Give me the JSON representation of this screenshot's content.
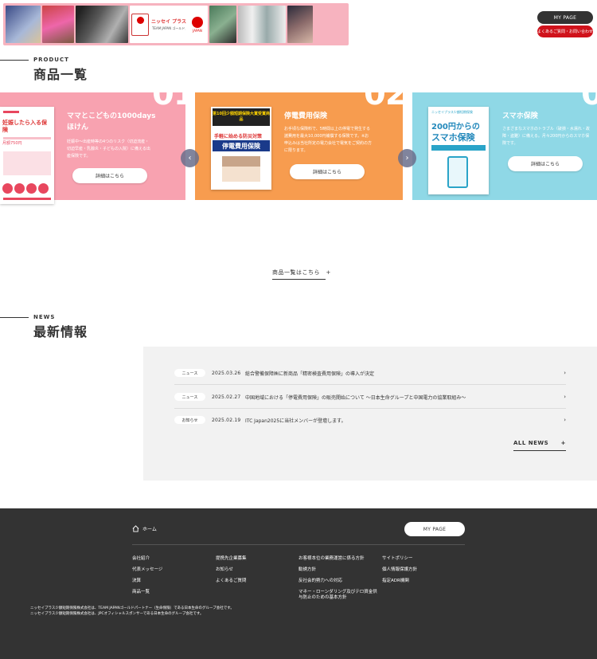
{
  "banner": {
    "promo_brand": "ニッセイ プラス",
    "promo_sub": "TEAM JAPAN ゴールドパートナー（生命保険）JPCオフィシャルスポンサー",
    "promo_japan": "JAPAN"
  },
  "header": {
    "mypage_label": "MY PAGE",
    "inquiry_label": "よくあるご質問・お問い合わせ"
  },
  "product_section": {
    "label": "PRODUCT",
    "title": "商品一覧",
    "numbers": [
      "01",
      "02",
      "0"
    ],
    "cards": [
      {
        "title": "ママとこどもの1000daysほけん",
        "desc": "妊娠中〜出産時等の4つのリスク（切迫流産・切迫早産・乳腺炎・子どもの入院）に備える出産保険です。",
        "button": "詳細はこちら",
        "img_head": "妊娠したら入る保険",
        "img_sub": "月額750円"
      },
      {
        "title": "停電費用保険",
        "desc": "お手頃な保険料で、5時間以上の停電で発生する諸費用を最大10,000円補償する保険です。※お申込みは当社所定の電力会社で電気をご契約の方に限ります。",
        "button": "詳細はこちら",
        "img_head": "第10回少額短期保険大賞受賞商品",
        "img_red": "手軽に始める防災対策",
        "img_banner": "停電費用保険"
      },
      {
        "title": "スマホ保険",
        "desc": "さまざまなスマホのトラブル（破損・水濡れ・故障・盗難）に備える。月々200円からのスマホ保険です。",
        "button": "詳細はこちら",
        "img_top": "ニッセイプラス少額短期保険",
        "img_price": "200円からの",
        "img_title": "スマホ保険"
      }
    ],
    "prev_icon": "‹",
    "next_icon": "›",
    "all_products_label": "商品一覧はこちら　+"
  },
  "news_section": {
    "label": "NEWS",
    "title": "最新情報",
    "items": [
      {
        "tag": "ニュース",
        "date": "2025.03.26",
        "title": "総合警備保障㈱に新商品「精密検査費用保険」の導入が決定"
      },
      {
        "tag": "ニュース",
        "date": "2025.02.27",
        "title": "中国地域における「停電費用保険」の販売開始について ～日本生命グループと中国電力の協業取組み～"
      },
      {
        "tag": "お知らせ",
        "date": "2025.02.19",
        "title": "ITC Japan2025に当社メンバーが登壇します。"
      }
    ],
    "chevron": "›",
    "all_news_label": "ALL NEWS",
    "all_news_plus": "+"
  },
  "footer": {
    "home_label": "ホーム",
    "mypage_label": "MY PAGE",
    "columns": [
      [
        "会社紹介",
        "代表メッセージ",
        "決算",
        "商品一覧"
      ],
      [
        "提携先企業募集",
        "お知らせ",
        "よくあるご質問"
      ],
      [
        "お客様本位の業務運営に係る方針",
        "勧誘方針",
        "反社会的勢力への対応",
        "マネー・ローンダリング及びテロ資金供与防止のための基本方針"
      ],
      [
        "サイトポリシー",
        "個人情報保護方針",
        "指定ADR機関"
      ]
    ],
    "copy_lines": [
      "ニッセイプラス少額短期保険株式会社は、TEAM JAPANゴールドパートナー（生命保険）である日本生命のグループ会社です。",
      "ニッセイプラス少額短期保険株式会社は、JPCオフィシャルスポンサーである日本生命のグループ会社です。"
    ]
  }
}
